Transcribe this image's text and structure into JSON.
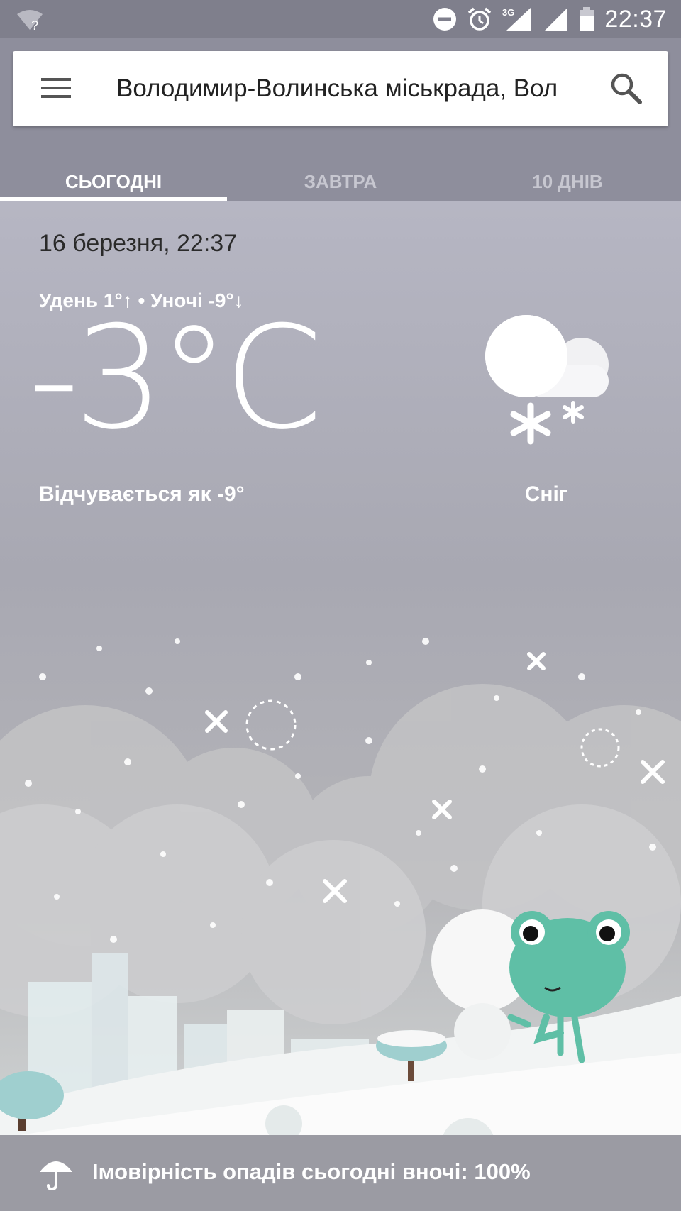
{
  "status_bar": {
    "time": "22:37",
    "network": "3G",
    "icons": [
      "wifi-unknown-icon",
      "do-not-disturb-icon",
      "alarm-icon",
      "signal-3g-icon",
      "signal-icon",
      "battery-icon"
    ]
  },
  "search": {
    "location": "Володимир-Волинська міськрада, Вол"
  },
  "tabs": [
    {
      "label": "СЬОГОДНІ",
      "active": true
    },
    {
      "label": "ЗАВТРА",
      "active": false
    },
    {
      "label": "10 ДНІВ",
      "active": false
    }
  ],
  "weather": {
    "datetime": "16 березня, 22:37",
    "high_low": "Удень 1°↑ • Уночі -9°↓",
    "temperature": "-3°C",
    "feels_like": "Відчувається як -9°",
    "condition": "Сніг",
    "condition_icon": "cloud-snow-icon"
  },
  "footer": {
    "precipitation": "Імовірність опадів сьогодні вночі: 100%",
    "icon": "umbrella-icon"
  },
  "colors": {
    "status_bar": "#7f7f8c",
    "header": "#8e8e9c",
    "frog": "#5fbfa6"
  }
}
